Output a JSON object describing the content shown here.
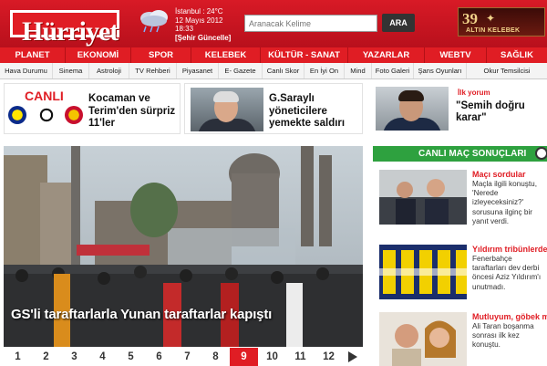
{
  "header": {
    "logo": "Hürriyet",
    "weather": {
      "line1": "İstanbul : 24°C",
      "line2": "12 Mayıs 2012",
      "line3": "18:33",
      "link": "[Şehir Güncelle]"
    },
    "search": {
      "placeholder": "Aranacak Kelime",
      "button": "ARA"
    },
    "promo": {
      "number": "39",
      "text": "ALTIN KELEBEK"
    }
  },
  "mainnav": [
    "PLANET",
    "EKONOMİ",
    "SPOR",
    "KELEBEK",
    "KÜLTÜR - SANAT",
    "YAZARLAR",
    "WEBTV",
    "SAĞLIK"
  ],
  "subnav": [
    "Hava Durumu",
    "Sinema",
    "Astroloji",
    "TV Rehberi",
    "Piyasanet",
    "E- Gazete",
    "Canlı Skor",
    "En İyi On",
    "Mind",
    "Foto Galeri",
    "Şans Oyunları",
    "Okur Temsilcisi"
  ],
  "teasers": [
    {
      "label": "CANLI",
      "title": "Kocaman ve Terim'den sürpriz 11'ler"
    },
    {
      "title": "G.Saraylı yöneticilere yemekte saldırı"
    },
    {
      "label": "İlk yorum",
      "title": "\"Semih doğru karar\""
    }
  ],
  "hero": {
    "caption": "GS'li taraftarlarla Yunan taraftarlar kapıştı",
    "pages": [
      "1",
      "2",
      "3",
      "4",
      "5",
      "6",
      "7",
      "8",
      "9",
      "10",
      "11",
      "12"
    ],
    "active_page": "9"
  },
  "sidebar": {
    "live_title": "CANLI MAÇ SONUÇLARI",
    "items": [
      {
        "title": "Maçı sordular",
        "text": [
          "Maçla ilgili konuştu,",
          "'Nerede",
          "izleyeceksiniz?'",
          "sorusuna ilginç bir",
          "yanıt verdi."
        ]
      },
      {
        "title": "Yıldırım tribünlerde",
        "text": [
          "Fenerbahçe",
          "taraftarları dev derbi",
          "öncesi Aziz Yıldırım'ı",
          "unutmadı."
        ]
      },
      {
        "title": "Mutluyum, göbek mi atayım",
        "text": [
          "Ali Taran boşanma",
          "sonrası ilk kez",
          "konuştu."
        ]
      }
    ]
  },
  "colors": {
    "brand_red": "#e01d24",
    "live_green": "#2ea13f"
  }
}
